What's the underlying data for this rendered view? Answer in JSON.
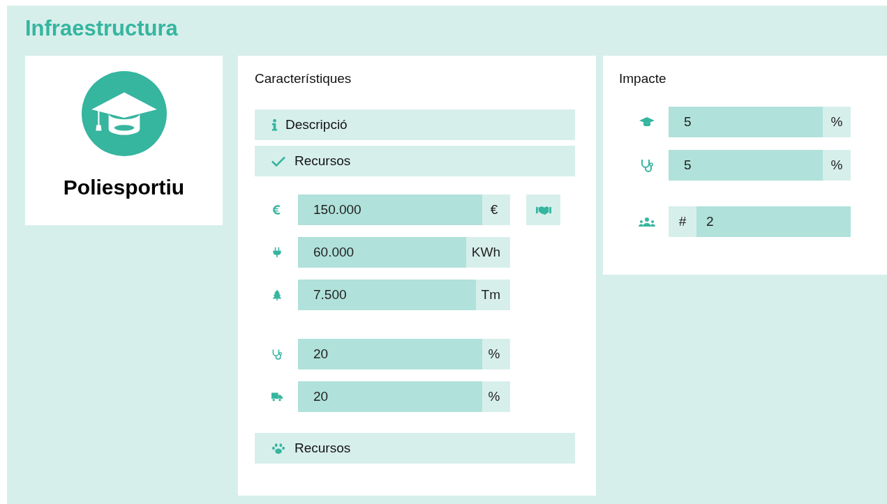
{
  "title": "Infraestructura",
  "facility": {
    "name": "Poliesportiu"
  },
  "characteristics": {
    "title": "Característiques",
    "sections": [
      {
        "label": "Descripció"
      },
      {
        "label": "Recursos",
        "expanded": true,
        "field_groups": [
          [
            {
              "value": "150.000",
              "unit": "€"
            },
            {
              "value": "60.000",
              "unit": "KWh"
            },
            {
              "value": "7.500",
              "unit": "Tm"
            }
          ],
          [
            {
              "value": "20",
              "unit": "%"
            },
            {
              "value": "20",
              "unit": "%"
            }
          ]
        ]
      },
      {
        "label": "Recursos"
      }
    ]
  },
  "impact": {
    "title": "Impacte",
    "rows": [
      {
        "kind": "suffix",
        "value": "5",
        "unit": "%"
      },
      {
        "kind": "suffix",
        "value": "5",
        "unit": "%"
      },
      {
        "kind": "prefix",
        "value": "2",
        "unit": "#"
      }
    ]
  }
}
